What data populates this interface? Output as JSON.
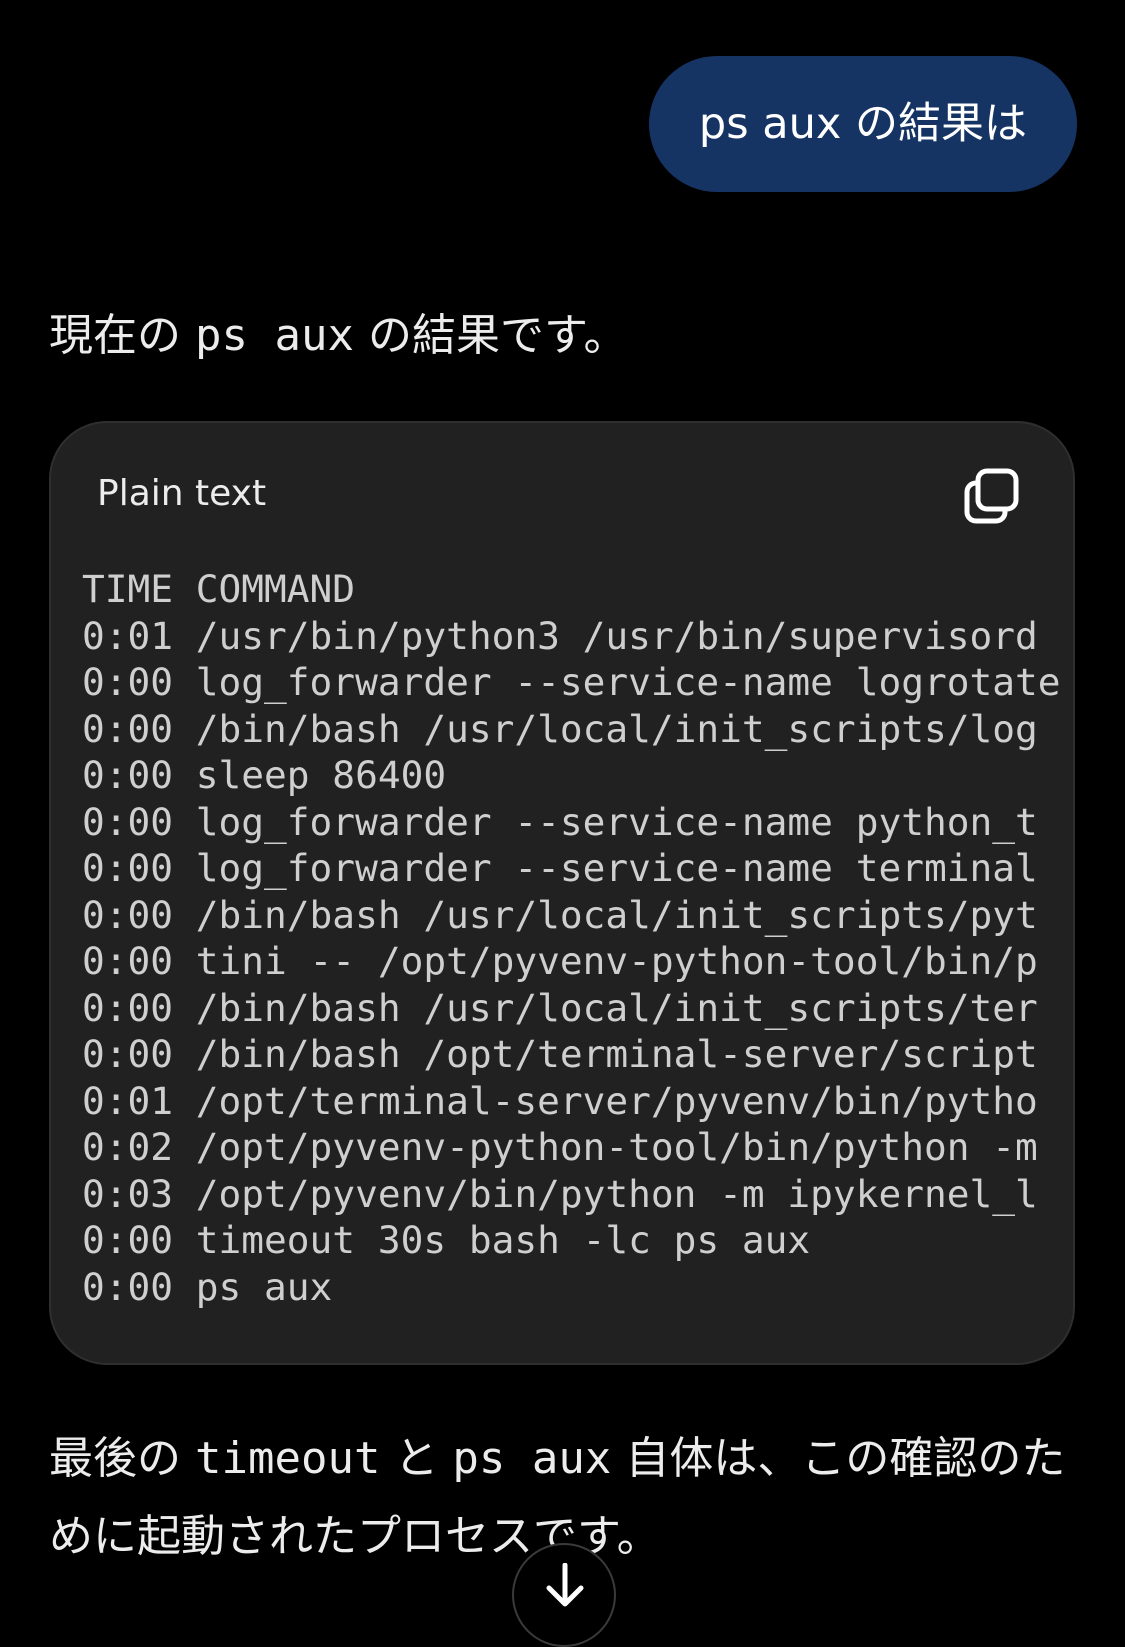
{
  "user_message": "ps aux の結果は",
  "assistant": {
    "intro": {
      "before": "現在の ",
      "code": "ps aux",
      "after": " の結果です。"
    },
    "code_block": {
      "language_label": "Plain text",
      "lines": [
        "TIME COMMAND",
        "0:01 /usr/bin/python3 /usr/bin/supervisord",
        "0:00 log_forwarder --service-name logrotate",
        "0:00 /bin/bash /usr/local/init_scripts/log",
        "0:00 sleep 86400",
        "0:00 log_forwarder --service-name python_t",
        "0:00 log_forwarder --service-name terminal",
        "0:00 /bin/bash /usr/local/init_scripts/pyt",
        "0:00 tini -- /opt/pyvenv-python-tool/bin/p",
        "0:00 /bin/bash /usr/local/init_scripts/ter",
        "0:00 /bin/bash /opt/terminal-server/script",
        "0:01 /opt/terminal-server/pyvenv/bin/pytho",
        "0:02 /opt/pyvenv-python-tool/bin/python -m",
        "0:03 /opt/pyvenv/bin/python -m ipykernel_l",
        "0:00 timeout 30s bash -lc ps aux",
        "0:00 ps aux"
      ]
    },
    "outro": {
      "part1": "最後の ",
      "code1": "timeout",
      "part2": " と ",
      "code2": "ps aux",
      "part3": " 自体は、この確認のために起動されたプロセスです。"
    }
  },
  "icons": {
    "copy": "copy-icon",
    "scroll_down": "arrow-down-icon"
  },
  "colors": {
    "background": "#000000",
    "user_bubble": "#163463",
    "code_block_bg": "#212121",
    "text": "#ececec"
  }
}
